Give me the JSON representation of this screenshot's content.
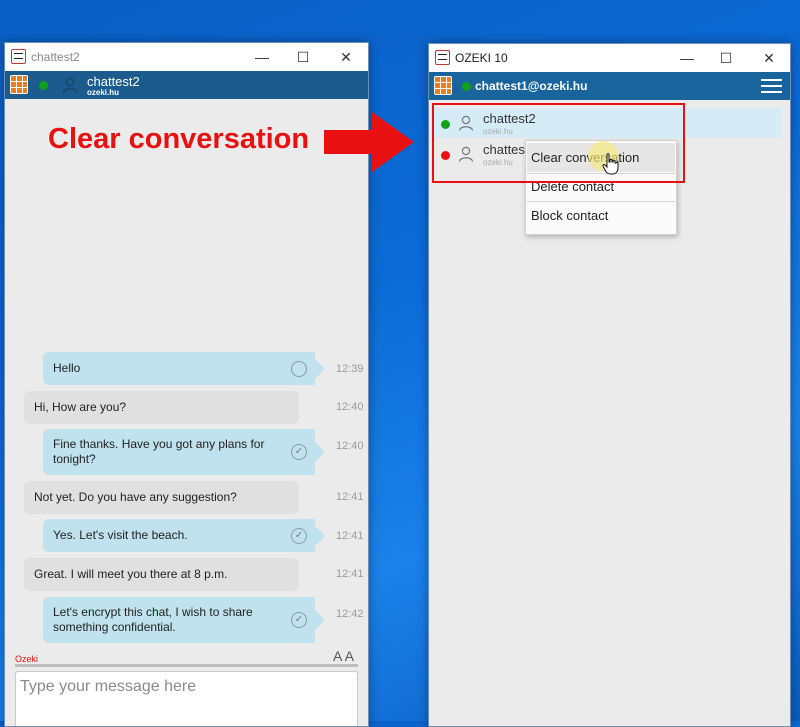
{
  "left_window": {
    "title": "chattest2",
    "contact_name": "chattest2",
    "contact_domain": "ozeki.hu",
    "messages": [
      {
        "text": "Hello",
        "time": "12:39",
        "dir": "out"
      },
      {
        "text": "Hi, How are you?",
        "time": "12:40",
        "dir": "in"
      },
      {
        "text": "Fine thanks. Have you got any plans for tonight?",
        "time": "12:40",
        "dir": "out"
      },
      {
        "text": "Not yet. Do you have any suggestion?",
        "time": "12:41",
        "dir": "in"
      },
      {
        "text": "Yes. Let's visit the beach.",
        "time": "12:41",
        "dir": "out"
      },
      {
        "text": "Great. I will meet you there at 8 p.m.",
        "time": "12:41",
        "dir": "in"
      },
      {
        "text": "Let's encrypt this chat, I wish to share something confidential.",
        "time": "12:42",
        "dir": "out"
      }
    ],
    "footer_brand": "Ozeki",
    "font_size_label": "A A",
    "input_placeholder": "Type your message here"
  },
  "right_window": {
    "title": "OZEKI 10",
    "account": "chattest1@ozeki.hu",
    "contacts": [
      {
        "name": "chattest2",
        "domain": "ozeki.hu",
        "status": "online"
      },
      {
        "name": "chattes",
        "domain": "ozeki.hu",
        "status": "offline"
      }
    ],
    "context_menu": [
      "Clear conversation",
      "Delete contact",
      "Block contact"
    ]
  },
  "annotation": {
    "text": "Clear conversation",
    "color": "#e81010"
  },
  "window_controls": {
    "minimize": "—",
    "maximize": "☐",
    "close": "✕"
  }
}
